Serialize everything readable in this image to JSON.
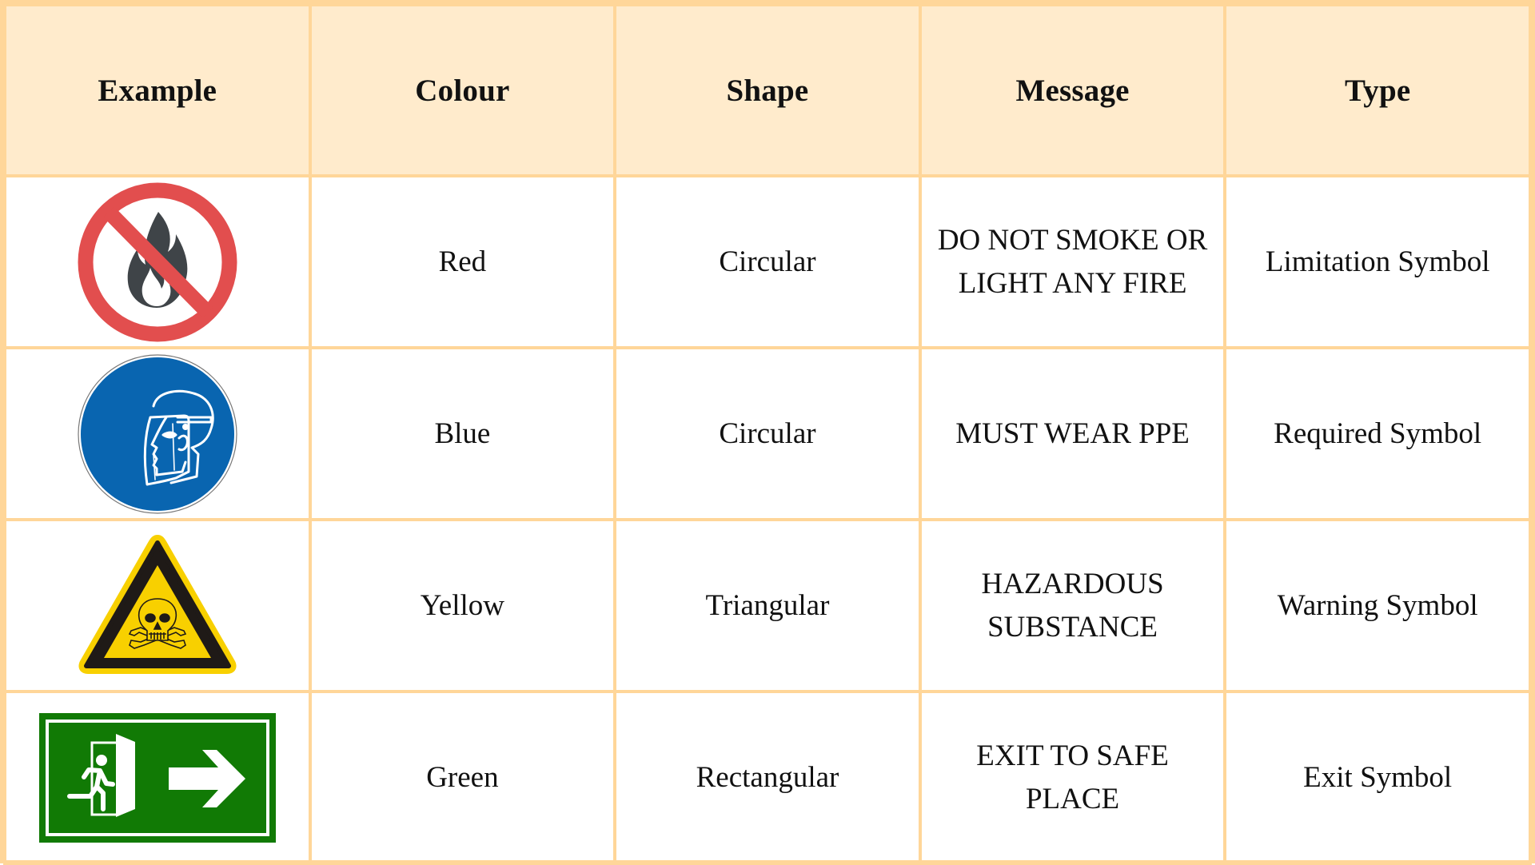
{
  "table": {
    "headers": [
      "Example",
      "Colour",
      "Shape",
      "Message",
      "Type"
    ],
    "rows": [
      {
        "icon": "no-fire-prohibition-sign-icon",
        "colour": "Red",
        "shape": "Circular",
        "message_lines": [
          "DO NOT SMOKE OR",
          "LIGHT ANY FIRE"
        ],
        "type": "Limitation Symbol"
      },
      {
        "icon": "face-shield-mandatory-sign-icon",
        "colour": "Blue",
        "shape": "Circular",
        "message_lines": [
          "MUST WEAR PPE"
        ],
        "type": "Required Symbol"
      },
      {
        "icon": "toxic-skull-warning-sign-icon",
        "colour": "Yellow",
        "shape": "Triangular",
        "message_lines": [
          "HAZARDOUS",
          "SUBSTANCE"
        ],
        "type": "Warning Symbol"
      },
      {
        "icon": "emergency-exit-sign-icon",
        "colour": "Green",
        "shape": "Rectangular",
        "message_lines": [
          "EXIT TO SAFE",
          "PLACE"
        ],
        "type": "Exit Symbol"
      }
    ]
  },
  "colors": {
    "grid_line": "#FFD699",
    "header_bg": "#FFEBCC",
    "prohibition_red": "#E24E4E",
    "flame_gray": "#3F4448",
    "mandatory_blue": "#0965B0",
    "warning_yellow": "#F8D000",
    "exit_green": "#117A05"
  }
}
